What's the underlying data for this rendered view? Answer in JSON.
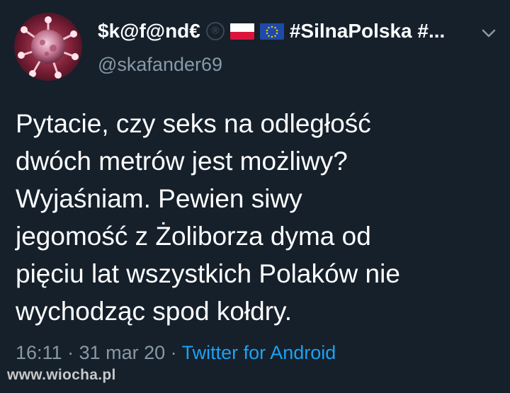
{
  "header": {
    "display_name": "$k@f@nd€",
    "registered_mark": "®",
    "hashtags": "#SilnaPolska #...",
    "handle": "@skafander69"
  },
  "icons": {
    "avatar": "virus-image",
    "flag_poland": "poland-flag-icon",
    "flag_eu": "eu-flag-icon",
    "menu": "chevron-down-icon"
  },
  "tweet": {
    "lines": [
      "Pytacie, czy seks na odległość",
      "dwóch metrów jest możliwy?",
      "Wyjaśniam. Pewien siwy",
      "jegomość z Żoliborza dyma od",
      "pięciu lat wszystkich Polaków nie",
      "wychodząc spod kołdry."
    ]
  },
  "meta": {
    "time": "16:11",
    "sep1": " · ",
    "date": "31 mar 20",
    "sep2": " · ",
    "app": "Twitter for Android"
  },
  "watermark": "www.wiocha.pl",
  "colors": {
    "background": "#15202b",
    "text": "#ffffff",
    "secondary": "#8899a6",
    "link": "#1da1f2"
  }
}
